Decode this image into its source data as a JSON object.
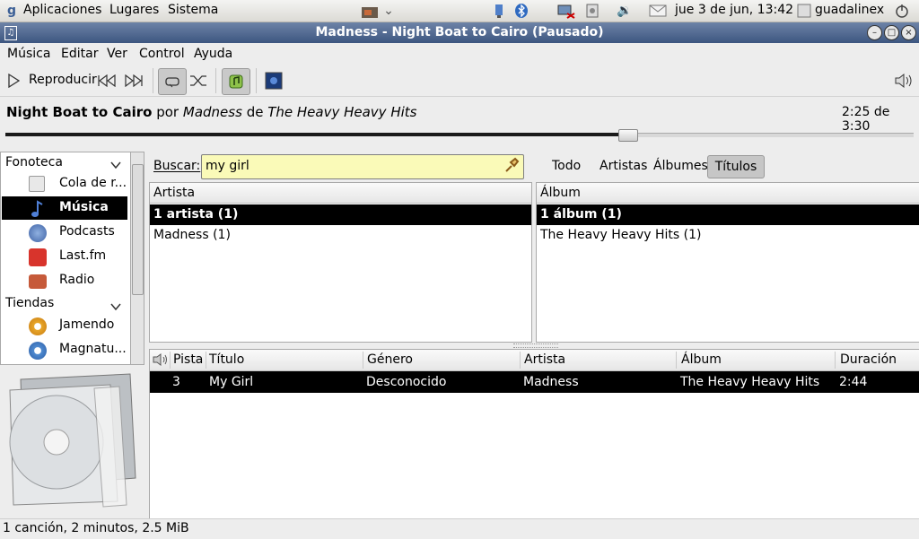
{
  "panel": {
    "menus": [
      "Aplicaciones",
      "Lugares",
      "Sistema"
    ],
    "datetime": "jue  3 de jun, 13:42",
    "user": "guadalinex"
  },
  "window": {
    "title": "Madness - Night Boat to Cairo (Pausado)"
  },
  "menubar": [
    "Música",
    "Editar",
    "Ver",
    "Control",
    "Ayuda"
  ],
  "toolbar": {
    "play_label": "Reproducir"
  },
  "now_playing": {
    "track": "Night Boat to Cairo",
    "by": "por",
    "artist": "Madness",
    "from": "de",
    "album": "The Heavy Heavy Hits",
    "time": "2:25 de 3:30",
    "progress": 0.69
  },
  "sidebar": {
    "library_header": "Fonoteca",
    "stores_header": "Tiendas",
    "library_items": [
      {
        "label": "Cola de r...",
        "icon": "queue-icon"
      },
      {
        "label": "Música",
        "icon": "music-note-icon",
        "selected": true
      },
      {
        "label": "Podcasts",
        "icon": "podcast-icon"
      },
      {
        "label": "Last.fm",
        "icon": "lastfm-icon"
      },
      {
        "label": "Radio",
        "icon": "radio-icon"
      }
    ],
    "store_items": [
      {
        "label": "Jamendo",
        "icon": "jamendo-icon"
      },
      {
        "label": "Magnatu...",
        "icon": "magnatune-icon"
      }
    ]
  },
  "search": {
    "label": "Buscar:",
    "value": "my girl",
    "filters": [
      "Todo",
      "Artistas",
      "Álbumes",
      "Títulos"
    ],
    "active_filter": "Títulos"
  },
  "artist_pane": {
    "header": "Artista",
    "rows": [
      "1 artista (1)",
      "Madness (1)"
    ]
  },
  "album_pane": {
    "header": "Álbum",
    "rows": [
      "1 álbum (1)",
      "The Heavy Heavy Hits (1)"
    ]
  },
  "tracks": {
    "columns": [
      "Pista",
      "Título",
      "Género",
      "Artista",
      "Álbum",
      "Duración"
    ],
    "rows": [
      {
        "track": "3",
        "title": "My Girl",
        "genre": "Desconocido",
        "artist": "Madness",
        "album": "The Heavy Heavy Hits",
        "duration": "2:44"
      }
    ]
  },
  "status": "1 canción, 2 minutos, 2.5 MiB"
}
